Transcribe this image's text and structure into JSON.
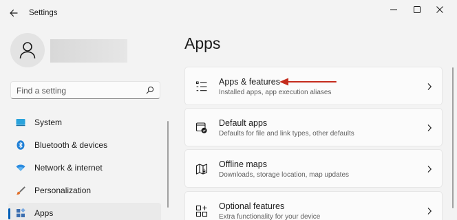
{
  "window": {
    "title": "Settings"
  },
  "search": {
    "placeholder": "Find a setting"
  },
  "sidebar": {
    "items": [
      {
        "label": "System",
        "icon": "system-icon",
        "active": false
      },
      {
        "label": "Bluetooth & devices",
        "icon": "bluetooth-icon",
        "active": false
      },
      {
        "label": "Network & internet",
        "icon": "wifi-icon",
        "active": false
      },
      {
        "label": "Personalization",
        "icon": "brush-icon",
        "active": false
      },
      {
        "label": "Apps",
        "icon": "apps-icon",
        "active": true
      }
    ]
  },
  "main": {
    "title": "Apps",
    "cards": [
      {
        "title": "Apps & features",
        "description": "Installed apps, app execution aliases",
        "icon": "apps-list-icon"
      },
      {
        "title": "Default apps",
        "description": "Defaults for file and link types, other defaults",
        "icon": "default-apps-icon"
      },
      {
        "title": "Offline maps",
        "description": "Downloads, storage location, map updates",
        "icon": "map-icon"
      },
      {
        "title": "Optional features",
        "description": "Extra functionality for your device",
        "icon": "optional-features-icon"
      }
    ]
  },
  "colors": {
    "accent": "#005fb8",
    "annotation": "#c42b1c",
    "background": "#f3f3f3"
  }
}
